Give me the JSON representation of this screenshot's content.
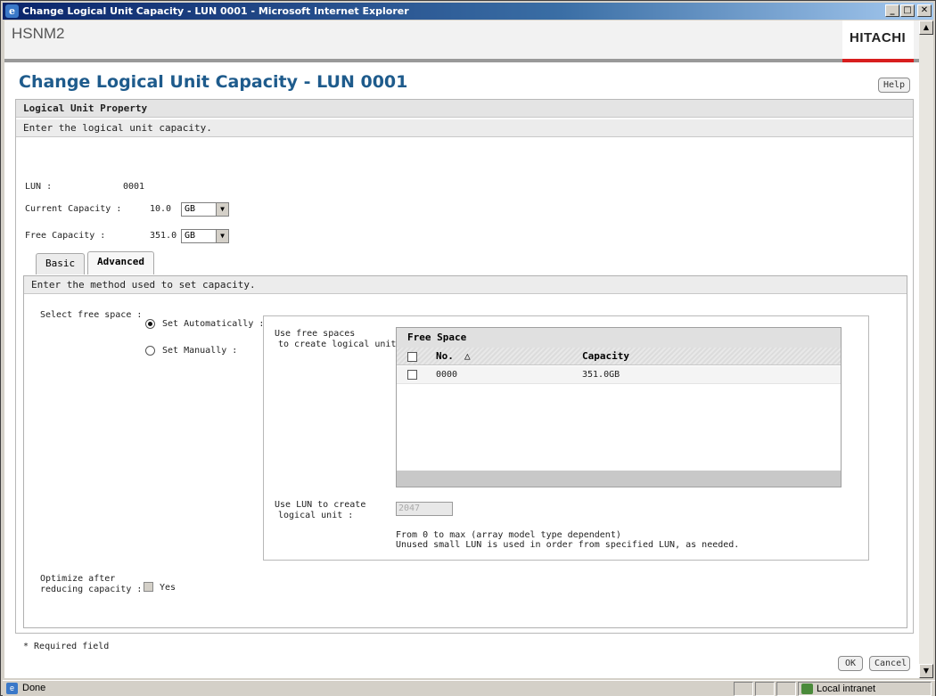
{
  "window": {
    "title": "Change Logical Unit Capacity - LUN 0001 - Microsoft Internet Explorer",
    "controls": {
      "minimize": "_",
      "restore": "□",
      "close": "✕"
    }
  },
  "header": {
    "app_name": "HSNM2",
    "logo_text": "HITACHI"
  },
  "page": {
    "title": "Change Logical Unit Capacity - LUN 0001",
    "help_label": "Help"
  },
  "property": {
    "section_title": "Logical Unit Property",
    "instruction": "Enter the logical unit capacity.",
    "lun_label": "LUN :",
    "lun_value": "0001",
    "current_capacity_label": "Current Capacity :",
    "current_capacity_value": "10.0",
    "current_capacity_unit": "GB",
    "free_capacity_label": "Free Capacity :",
    "free_capacity_value": "351.0",
    "free_capacity_unit": "GB"
  },
  "tabs": [
    {
      "label": "Basic",
      "active": false
    },
    {
      "label": "Advanced",
      "active": true
    }
  ],
  "advanced": {
    "instruction": "Enter the method used to set capacity.",
    "select_free_space_label": "Select free space :",
    "set_automatically_label": "Set Automatically :",
    "set_automatically_selected": true,
    "set_manually_label": "Set Manually :",
    "set_manually_selected": false,
    "use_free_spaces_label_line1": "Use free spaces",
    "use_free_spaces_label_line2": "to create logical unit :",
    "free_space_table": {
      "title": "Free Space",
      "columns": [
        "No.",
        "Capacity"
      ],
      "sort_indicator": "△",
      "rows": [
        {
          "no": "0000",
          "capacity": "351.0GB"
        }
      ]
    },
    "use_lun_label_line1": "Use LUN to create",
    "use_lun_label_line2": "logical unit :",
    "use_lun_value": "2047",
    "lun_hint_line1": "From 0 to max (array model type dependent)",
    "lun_hint_line2": "Unused small LUN is used in order from specified LUN, as needed.",
    "optimize_label_line1": "Optimize after",
    "optimize_label_line2": "reducing capacity :",
    "optimize_option": "Yes"
  },
  "footer": {
    "required_note": "* Required field",
    "ok_label": "OK",
    "cancel_label": "Cancel"
  },
  "statusbar": {
    "text": "Done",
    "zone": "Local intranet"
  }
}
